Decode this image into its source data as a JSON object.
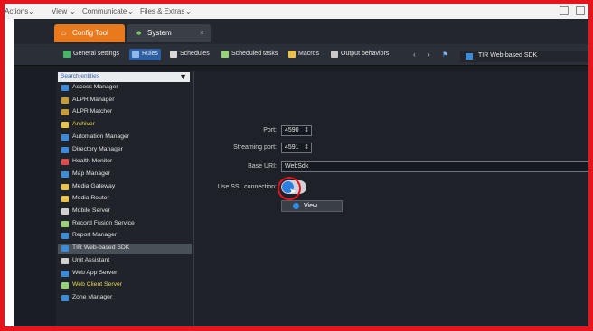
{
  "menu": {
    "items": [
      "Actions",
      "View",
      "Communicate",
      "Files & Extras"
    ]
  },
  "tabs": [
    {
      "label": "Config Tool",
      "icon": "home-icon",
      "color": "#e8791c"
    },
    {
      "label": "System",
      "icon": "leaf-icon"
    }
  ],
  "toolbar": {
    "items": [
      {
        "label": "General settings",
        "icon": "gear-icon"
      },
      {
        "label": "Rules",
        "icon": "rules-icon",
        "active": true
      },
      {
        "label": "Schedules",
        "icon": "calendar-icon"
      },
      {
        "label": "Scheduled tasks",
        "icon": "task-icon"
      },
      {
        "label": "Macros",
        "icon": "macro-icon"
      },
      {
        "label": "Output behaviors",
        "icon": "output-icon"
      }
    ],
    "breadcrumb": "TIR Web-based SDK"
  },
  "sidebar": {
    "search_placeholder": "Search entities",
    "items": [
      {
        "label": "Access Manager"
      },
      {
        "label": "ALPR Manager"
      },
      {
        "label": "ALPR Matcher"
      },
      {
        "label": "Archiver",
        "highlight": "yellow"
      },
      {
        "label": "Automation Manager"
      },
      {
        "label": "Directory Manager"
      },
      {
        "label": "Health Monitor"
      },
      {
        "label": "Map Manager"
      },
      {
        "label": "Media Gateway"
      },
      {
        "label": "Media Router"
      },
      {
        "label": "Mobile Server"
      },
      {
        "label": "Record Fusion Service"
      },
      {
        "label": "Report Manager"
      },
      {
        "label": "TIR Web-based SDK",
        "selected": true
      },
      {
        "label": "Unit Assistant"
      },
      {
        "label": "Web App Server"
      },
      {
        "label": "Web Client Server",
        "highlight": "yellow"
      },
      {
        "label": "Zone Manager"
      }
    ]
  },
  "form": {
    "port_label": "Port:",
    "port_value": "4590",
    "streaming_port_label": "Streaming port:",
    "streaming_port_value": "4591",
    "base_uri_label": "Base URI:",
    "base_uri_value": "WebSdk",
    "ssl_label": "Use SSL connection:",
    "ssl_enabled": true,
    "view_button": "View"
  },
  "colors": {
    "accent": "#2b7de0",
    "frame": "#e8141c",
    "tab_orange": "#e8791c"
  }
}
